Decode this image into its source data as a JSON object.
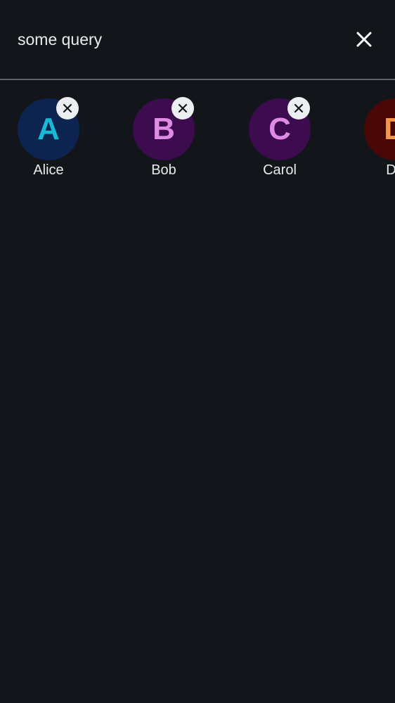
{
  "search": {
    "value": "some query",
    "clear_icon": "close-icon"
  },
  "contacts": [
    {
      "initial": "A",
      "name": "Alice",
      "avatar_bg": "#0d2450",
      "initial_color": "#19b8d6",
      "remove_icon": "close-icon"
    },
    {
      "initial": "B",
      "name": "Bob",
      "avatar_bg": "#3d0c4f",
      "initial_color": "#de8be3",
      "remove_icon": "close-icon"
    },
    {
      "initial": "C",
      "name": "Carol",
      "avatar_bg": "#3d0c4f",
      "initial_color": "#de8be3",
      "remove_icon": "close-icon"
    },
    {
      "initial": "D",
      "name": "Da",
      "avatar_bg": "#4a0707",
      "initial_color": "#f3974a"
    }
  ],
  "colors": {
    "background": "#12161b",
    "text": "#e8eaed",
    "divider": "#5f6368",
    "remove_badge": "#eceff1"
  }
}
